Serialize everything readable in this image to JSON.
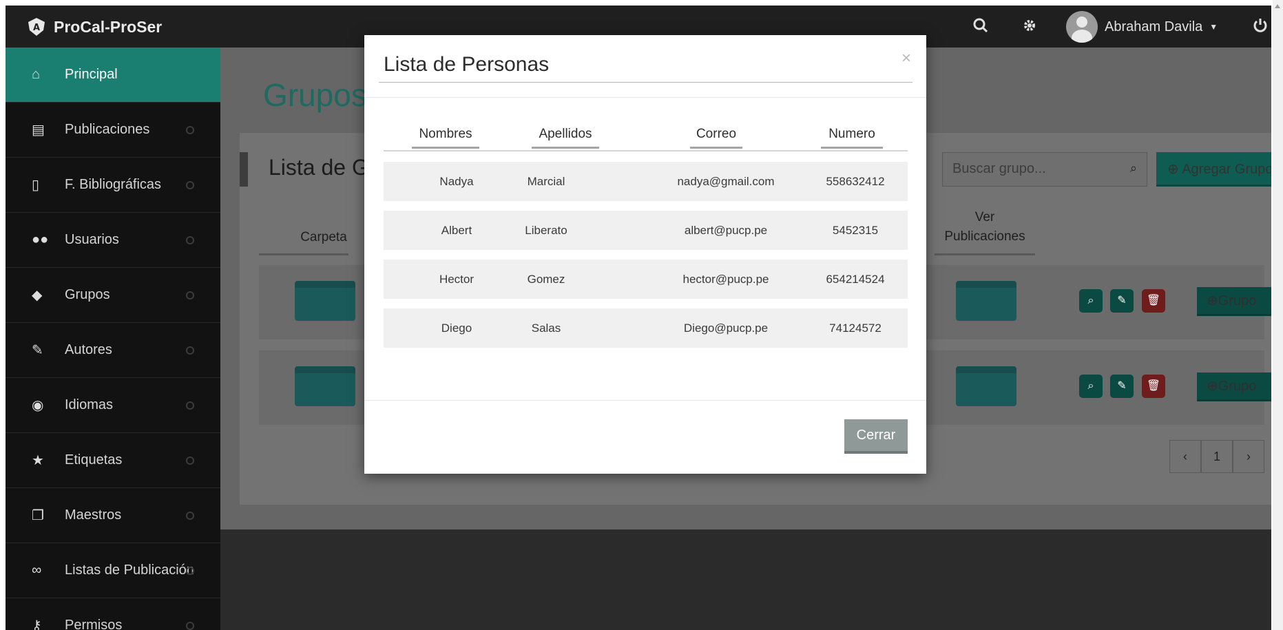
{
  "brand": {
    "name": "ProCal-ProSer"
  },
  "user": {
    "name": "Abraham Davila"
  },
  "sidebar": {
    "items": [
      {
        "label": "Principal",
        "icon": "home-icon",
        "active": true
      },
      {
        "label": "Publicaciones",
        "icon": "book-icon"
      },
      {
        "label": "F. Bibliográficas",
        "icon": "file-icon"
      },
      {
        "label": "Usuarios",
        "icon": "users-icon"
      },
      {
        "label": "Grupos",
        "icon": "comments-icon"
      },
      {
        "label": "Autores",
        "icon": "edit-icon"
      },
      {
        "label": "Idiomas",
        "icon": "globe-icon"
      },
      {
        "label": "Etiquetas",
        "icon": "star-icon"
      },
      {
        "label": "Maestros",
        "icon": "clone-icon"
      },
      {
        "label": "Listas de Publicación",
        "icon": "link-icon"
      },
      {
        "label": "Permisos",
        "icon": "key-icon"
      }
    ]
  },
  "main": {
    "title": "Grupos",
    "panel_title": "Lista de G",
    "search_placeholder": "Buscar grupo...",
    "add_button": "Agregar Grupo",
    "columns": {
      "carpeta": "Carpeta",
      "ver_publicaciones_1": "Ver",
      "ver_publicaciones_2": "Publicaciones"
    },
    "row_button": "Grupo",
    "pagination": {
      "current": "1"
    }
  },
  "modal": {
    "title": "Lista de Personas",
    "close": "×",
    "headers": [
      "Nombres",
      "Apellidos",
      "Correo",
      "Numero"
    ],
    "rows": [
      [
        "Nadya",
        "Marcial",
        "nadya@gmail.com",
        "558632412"
      ],
      [
        "Albert",
        "Liberato",
        "albert@pucp.pe",
        "5452315"
      ],
      [
        "Hector",
        "Gomez",
        "hector@pucp.pe",
        "654214524"
      ],
      [
        "Diego",
        "Salas",
        "Diego@pucp.pe",
        "74124572"
      ]
    ],
    "close_button": "Cerrar"
  },
  "colors": {
    "accent": "#1a7f70",
    "navbar": "#1f1f1f",
    "sidebar": "#121212",
    "danger": "#c0392b"
  }
}
